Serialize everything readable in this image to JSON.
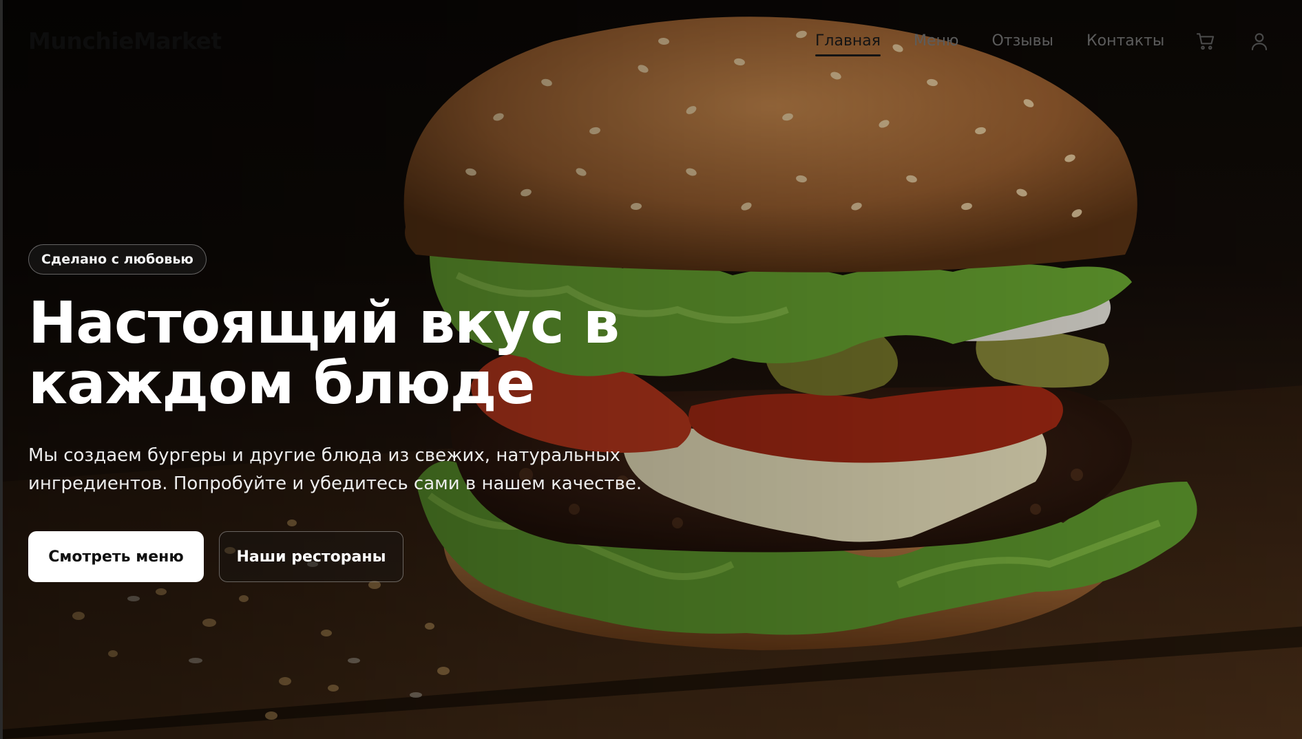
{
  "brand": {
    "logo_text": "MunchieMarket"
  },
  "nav": {
    "items": [
      {
        "label": "Главная",
        "active": true
      },
      {
        "label": "Меню",
        "active": false
      },
      {
        "label": "Отзывы",
        "active": false
      },
      {
        "label": "Контакты",
        "active": false
      }
    ],
    "icons": {
      "cart": "cart-icon",
      "user": "user-icon"
    }
  },
  "hero": {
    "badge": "Сделано с любовью",
    "title_line1": "Настоящий вкус в",
    "title_line2": "каждом блюде",
    "subtitle_line1": "Мы создаем бургеры и другие блюда из свежих, натуральных",
    "subtitle_line2": "ингредиентов. Попробуйте и убедитесь сами в нашем качестве.",
    "primary_button": "Смотреть меню",
    "secondary_button": "Наши рестораны"
  },
  "colors": {
    "primary_button_bg": "#ffffff",
    "text_light": "#ffffff",
    "nav_active": "#141414",
    "nav_inactive": "#5c5c5c"
  }
}
